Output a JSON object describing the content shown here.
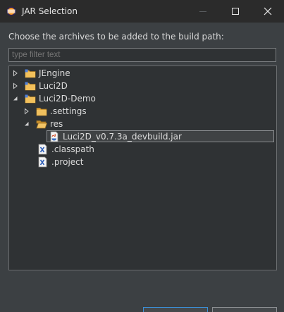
{
  "window": {
    "title": "JAR Selection",
    "controls": {
      "minimize": "minimize-icon",
      "maximize": "maximize-icon",
      "close": "close-icon"
    }
  },
  "dialog": {
    "prompt": "Choose the archives to be added to the build path:",
    "filter": {
      "value": "",
      "placeholder": "type filter text"
    }
  },
  "tree": {
    "items": [
      {
        "label": "JEngine",
        "icon": "project-folder-icon",
        "twisty": "collapsed"
      },
      {
        "label": "Luci2D",
        "icon": "project-folder-icon",
        "twisty": "collapsed"
      },
      {
        "label": "Luci2D-Demo",
        "icon": "project-folder-icon",
        "twisty": "expanded"
      },
      {
        "label": ".settings",
        "icon": "folder-icon",
        "twisty": "collapsed"
      },
      {
        "label": "res",
        "icon": "open-folder-icon",
        "twisty": "expanded"
      },
      {
        "label": "Luci2D_v0.7.3a_devbuild.jar",
        "icon": "jar-file-icon",
        "twisty": "none",
        "selected": true
      },
      {
        "label": ".classpath",
        "icon": "xml-file-icon",
        "twisty": "none"
      },
      {
        "label": ".project",
        "icon": "xml-file-icon",
        "twisty": "none"
      }
    ]
  },
  "colors": {
    "titlebar": "#2b2b2b",
    "background": "#3c4043",
    "panel": "#2f3234",
    "accent": "#3b8fd6"
  }
}
